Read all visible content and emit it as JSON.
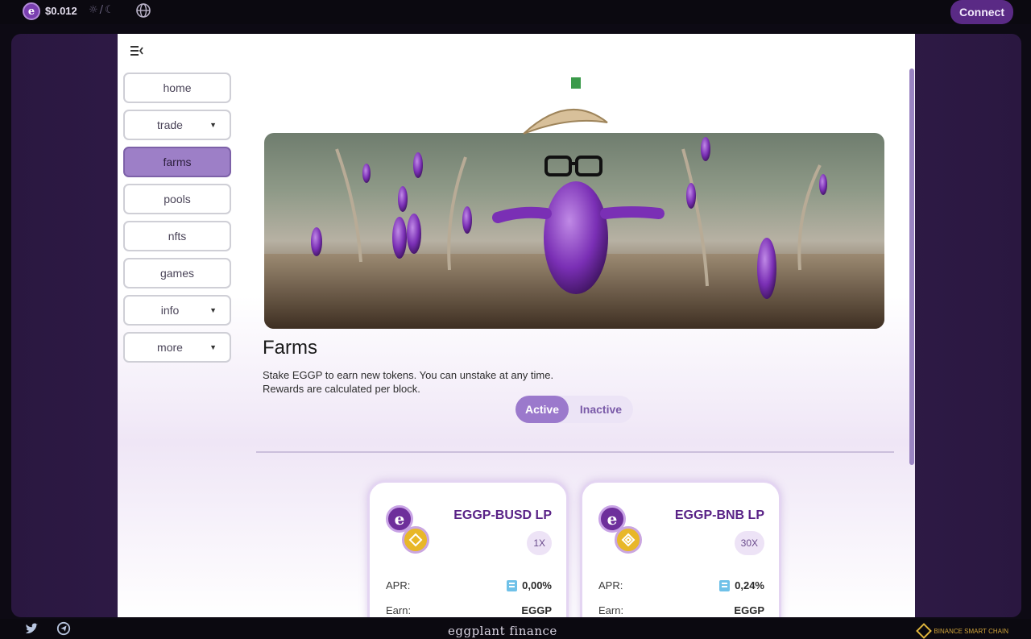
{
  "topbar": {
    "token_price": "$0.012",
    "theme_sun": "☼",
    "theme_sep": "/",
    "theme_moon": "☾",
    "connect_label": "Connect"
  },
  "nav": {
    "items": [
      {
        "label": "home",
        "caret": false,
        "active": false
      },
      {
        "label": "trade",
        "caret": true,
        "active": false
      },
      {
        "label": "farms",
        "caret": false,
        "active": true
      },
      {
        "label": "pools",
        "caret": false,
        "active": false
      },
      {
        "label": "nfts",
        "caret": false,
        "active": false
      },
      {
        "label": "games",
        "caret": false,
        "active": false
      },
      {
        "label": "info",
        "caret": true,
        "active": false
      },
      {
        "label": "more",
        "caret": true,
        "active": false
      }
    ]
  },
  "farms": {
    "title": "Farms",
    "desc_line1": "Stake EGGP to earn new tokens. You can unstake at any time.",
    "desc_line2": "Rewards are calculated per block.",
    "toggle_active": "Active",
    "toggle_inactive": "Inactive"
  },
  "cards": [
    {
      "pair": "EGGP-BUSD LP",
      "multiplier": "1X",
      "apr_label": "APR:",
      "apr_value": "0,00%",
      "earn_label": "Earn:",
      "earn_value": "EGGP"
    },
    {
      "pair": "EGGP-BNB LP",
      "multiplier": "30X",
      "apr_label": "APR:",
      "apr_value": "0,24%",
      "earn_label": "Earn:",
      "earn_value": "EGGP"
    }
  ],
  "footer": {
    "brand": "eggplant finance",
    "chain": "BINANCE SMART CHAIN"
  },
  "colors": {
    "accent": "#5a2a85",
    "active_nav": "#9d7fc7",
    "pair_name": "#5a2387"
  }
}
